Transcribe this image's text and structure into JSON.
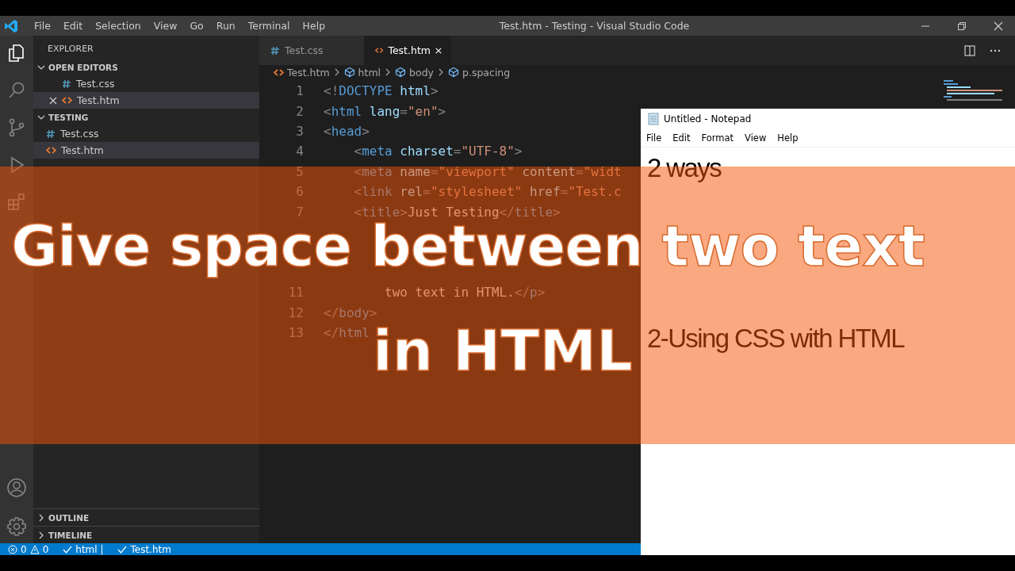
{
  "window": {
    "title": "Test.htm - Testing - Visual Studio Code"
  },
  "menu": [
    "File",
    "Edit",
    "Selection",
    "View",
    "Go",
    "Run",
    "Terminal",
    "Help"
  ],
  "sidebar": {
    "title": "EXPLORER",
    "sections": [
      {
        "label": "OPEN EDITORS",
        "expanded": true,
        "items": [
          {
            "name": "Test.css",
            "kind": "css",
            "selected": false,
            "closable": false
          },
          {
            "name": "Test.htm",
            "kind": "html",
            "selected": true,
            "closable": true
          }
        ]
      },
      {
        "label": "TESTING",
        "expanded": true,
        "items": [
          {
            "name": "Test.css",
            "kind": "css",
            "selected": false
          },
          {
            "name": "Test.htm",
            "kind": "html",
            "selected": true
          }
        ]
      }
    ],
    "bottom_sections": [
      {
        "label": "OUTLINE",
        "expanded": false
      },
      {
        "label": "TIMELINE",
        "expanded": false
      }
    ]
  },
  "tabs": [
    {
      "label": "Test.css",
      "kind": "css",
      "selected": false
    },
    {
      "label": "Test.htm",
      "kind": "html",
      "selected": true
    }
  ],
  "breadcrumbs": [
    {
      "label": "Test.htm",
      "kind": "file"
    },
    {
      "label": "html",
      "kind": "symbol"
    },
    {
      "label": "body",
      "kind": "symbol"
    },
    {
      "label": "p.spacing",
      "kind": "symbol"
    }
  ],
  "code_top": [
    {
      "number": "1",
      "tokens": [
        {
          "kind": "punct",
          "t": "<!"
        },
        {
          "kind": "tag",
          "t": "DOCTYPE"
        },
        {
          "kind": "attr",
          "t": " html"
        },
        {
          "kind": "punct",
          "t": ">"
        }
      ]
    },
    {
      "number": "2",
      "tokens": [
        {
          "kind": "punct",
          "t": "<"
        },
        {
          "kind": "tag",
          "t": "html"
        },
        {
          "kind": "attr",
          "t": " lang"
        },
        {
          "kind": "punct",
          "t": "="
        },
        {
          "kind": "string",
          "t": "\"en\""
        },
        {
          "kind": "punct",
          "t": ">"
        }
      ]
    },
    {
      "number": "3",
      "tokens": [
        {
          "kind": "punct",
          "t": "<"
        },
        {
          "kind": "tag",
          "t": "head"
        },
        {
          "kind": "punct",
          "t": ">"
        }
      ]
    },
    {
      "number": "4",
      "tokens": [
        {
          "kind": "punct",
          "t": "    <"
        },
        {
          "kind": "tag",
          "t": "meta"
        },
        {
          "kind": "attr",
          "t": " charset"
        },
        {
          "kind": "punct",
          "t": "="
        },
        {
          "kind": "string",
          "t": "\"UTF-8\""
        },
        {
          "kind": "punct",
          "t": ">"
        }
      ]
    },
    {
      "number": "5",
      "tokens": [
        {
          "kind": "punct",
          "t": "    <"
        },
        {
          "kind": "tag",
          "t": "meta"
        },
        {
          "kind": "attr",
          "t": " name"
        },
        {
          "kind": "punct",
          "t": "="
        },
        {
          "kind": "string",
          "t": "\"viewport\""
        },
        {
          "kind": "attr",
          "t": " content"
        },
        {
          "kind": "punct",
          "t": "="
        },
        {
          "kind": "string",
          "t": "\"widt"
        }
      ]
    },
    {
      "number": "6",
      "tokens": [
        {
          "kind": "punct",
          "t": "    <"
        },
        {
          "kind": "tag",
          "t": "link"
        },
        {
          "kind": "attr",
          "t": " rel"
        },
        {
          "kind": "punct",
          "t": "="
        },
        {
          "kind": "string",
          "t": "\"stylesheet\""
        },
        {
          "kind": "attr",
          "t": " href"
        },
        {
          "kind": "punct",
          "t": "="
        },
        {
          "kind": "string",
          "t": "\"Test.c"
        }
      ]
    },
    {
      "number": "7",
      "tokens": [
        {
          "kind": "punct",
          "t": "    <"
        },
        {
          "kind": "tag",
          "t": "title"
        },
        {
          "kind": "punct",
          "t": ">"
        },
        {
          "kind": "text",
          "t": "Just Testing"
        },
        {
          "kind": "punct",
          "t": "</"
        },
        {
          "kind": "tag",
          "t": "title"
        },
        {
          "kind": "punct",
          "t": ">"
        }
      ]
    }
  ],
  "code_bottom": [
    {
      "number": "11",
      "tokens": [
        {
          "kind": "text",
          "t": "        two text in HTML."
        },
        {
          "kind": "punct",
          "t": "</"
        },
        {
          "kind": "tag",
          "t": "p"
        },
        {
          "kind": "punct",
          "t": ">"
        }
      ]
    },
    {
      "number": "12",
      "tokens": [
        {
          "kind": "punct",
          "t": "</"
        },
        {
          "kind": "tag",
          "t": "body"
        },
        {
          "kind": "punct",
          "t": ">"
        }
      ]
    },
    {
      "number": "13",
      "tokens": [
        {
          "kind": "punct",
          "t": "</"
        },
        {
          "kind": "tag",
          "t": "html"
        }
      ]
    }
  ],
  "status_bar": {
    "errors": "0",
    "warnings": "0",
    "items": [
      "html |",
      "Test.htm"
    ]
  },
  "notepad": {
    "title": "Untitled - Notepad",
    "menu": [
      "File",
      "Edit",
      "Format",
      "View",
      "Help"
    ],
    "lines": [
      "2 ways",
      "2-Using CSS with HTML"
    ]
  },
  "overlay_title": [
    "Give space between two text",
    "in HTML"
  ]
}
